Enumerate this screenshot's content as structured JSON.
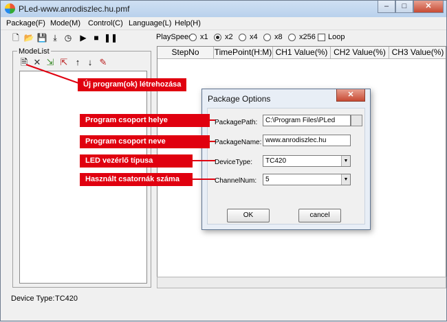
{
  "window": {
    "title": "PLed-www.anrodiszlec.hu.pmf",
    "minimize": "–",
    "maximize": "□",
    "close": "✕"
  },
  "menu": [
    "Package(F)",
    "Mode(M)",
    "Control(C)",
    "Language(L)",
    "Help(H)"
  ],
  "toolbar_icons": [
    "new-icon",
    "open-icon",
    "save-icon",
    "download-icon",
    "timer-icon",
    "play-icon",
    "stop-icon",
    "pause-icon"
  ],
  "playspeed": {
    "label": "PlaySpeed:",
    "options": [
      "x1",
      "x2",
      "x4",
      "x8",
      "x256"
    ],
    "selected": "x2",
    "loop_label": "Loop",
    "loop_checked": false
  },
  "modelist": {
    "label": "ModeList",
    "icons": [
      "new-program-icon",
      "delete-icon",
      "import-icon",
      "export-icon",
      "move-up-icon",
      "move-down-icon",
      "edit-icon"
    ]
  },
  "grid": {
    "columns": [
      "StepNo",
      "TimePoint(H:M)",
      "CH1 Value(%)",
      "CH2 Value(%)",
      "CH3 Value(%)"
    ]
  },
  "status": {
    "label": "Device Type:",
    "value": "TC420"
  },
  "dialog": {
    "title": "Package Options",
    "close": "✕",
    "package_path_label": "PackagePath:",
    "package_path_value": "C:\\Program Files\\PLed",
    "package_name_label": "PackageName:",
    "package_name_value": "www.anrodiszlec.hu",
    "device_type_label": "DeviceType:",
    "device_type_value": "TC420",
    "channel_num_label": "ChannelNum:",
    "channel_num_value": "5",
    "ok_label": "OK",
    "cancel_label": "cancel"
  },
  "callouts": {
    "new_program": "Új program(ok) létrehozása",
    "program_group_location": "Program csoport helye",
    "program_group_name": "Program csoport neve",
    "led_controller_type": "LED vezérlő típusa",
    "channels_used": "Használt csatornák száma"
  },
  "colors": {
    "callout_red": "#e0000f",
    "titlebar": "#c5d9f0"
  }
}
